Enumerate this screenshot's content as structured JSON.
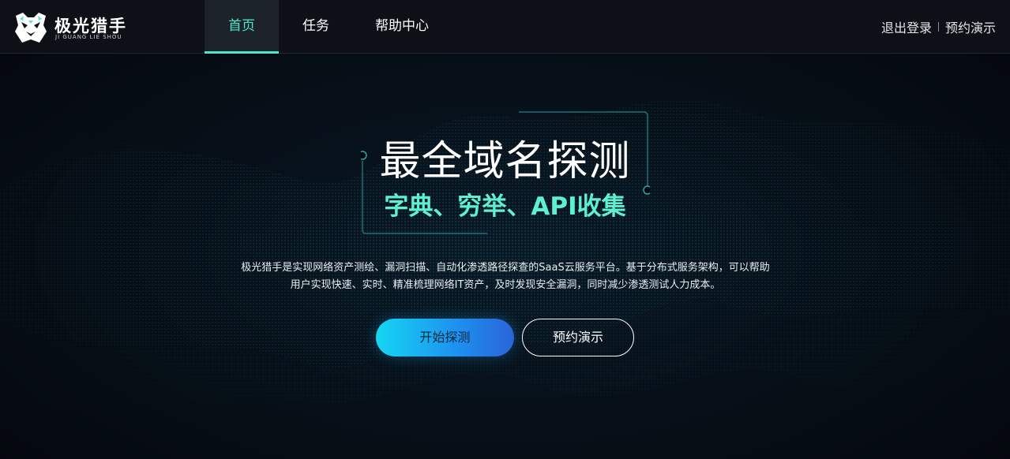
{
  "header": {
    "logo_title": "极光猎手",
    "logo_subtitle": "JI GUANG LIE SHOU",
    "nav": [
      {
        "label": "首页",
        "active": true
      },
      {
        "label": "任务",
        "active": false
      },
      {
        "label": "帮助中心",
        "active": false
      }
    ],
    "logout_label": "退出登录",
    "demo_label": "预约演示"
  },
  "hero": {
    "title": "最全域名探测",
    "subtitle": "字典、穷举、API收集",
    "description_line1": "极光猎手是实现网络资产测绘、漏洞扫描、自动化渗透路径探查的SaaS云服务平台。基于分布式服务架构，可以帮助",
    "description_line2": "用户实现快速、实时、精准梳理网络IT资产，及时发现安全漏洞，同时减少渗透测试人力成本。",
    "start_button": "开始探测",
    "demo_button": "预约演示"
  },
  "colors": {
    "accent": "#4ee6cf",
    "subtitle": "#5ef0d2",
    "header_bg": "#0d1117",
    "background": "#05080f",
    "button_gradient_start": "#15d6f2",
    "button_gradient_end": "#2a63d6"
  },
  "icons": {
    "logo": "tiger-head-logo-icon"
  }
}
